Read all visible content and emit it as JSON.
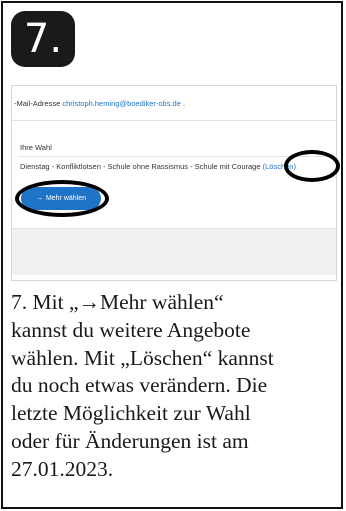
{
  "step": {
    "number": "7."
  },
  "screenshot": {
    "email_label": "-Mail-Adresse",
    "email_value": "christoph.heming@boediker-obs.de",
    "email_suffix": ".",
    "choice_heading": "Ihre Wahl",
    "choice_text": "Dienstag - Konfliktlotsen - Schule ohne Rassismus - Schule mit Courage",
    "delete_link": "(Löschen)",
    "more_button_icon": "→",
    "more_button_label": "Mehr wählen"
  },
  "caption": {
    "lines": [
      "7. Mit „→Mehr wählen“",
      "kannst du weitere Angebote",
      "wählen. Mit „Löschen“ kannst",
      "du noch etwas verändern. Die",
      "letzte Möglichkeit zur Wahl",
      "oder für Änderungen ist am",
      "27.01.2023."
    ]
  },
  "colors": {
    "accent": "#1f74c8",
    "badge": "#1a1a1a",
    "highlight_ring": "#000000"
  }
}
